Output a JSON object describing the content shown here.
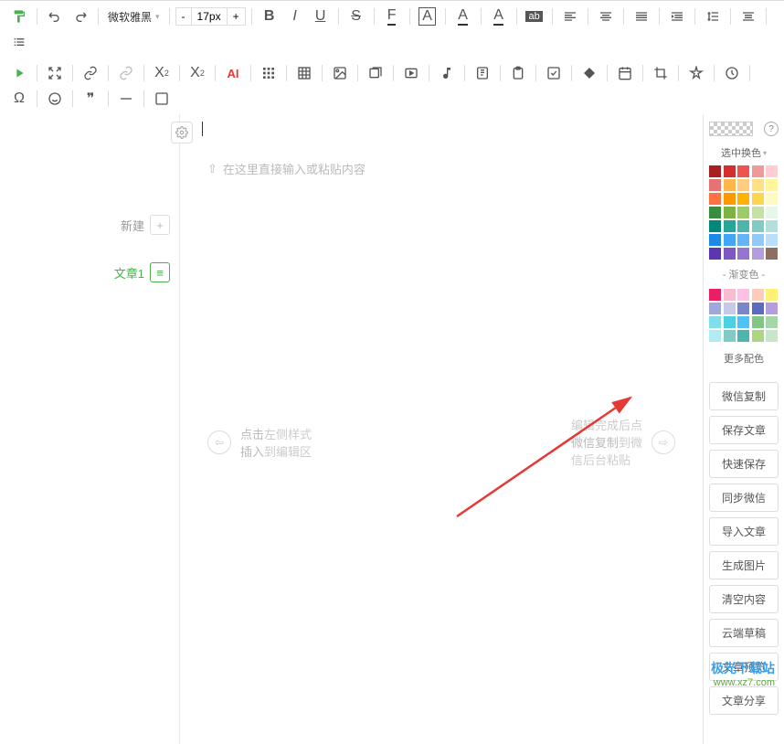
{
  "toolbar": {
    "font_family": "微软雅黑",
    "font_size": "17px",
    "minus": "-",
    "plus": "+"
  },
  "sidebar": {
    "new_label": "新建",
    "article_label": "文章1"
  },
  "editor": {
    "placeholder_text": "在这里直接输入或粘贴内容",
    "left_hint_1": "点击",
    "left_hint_2": "左侧样式",
    "left_hint_3": "插入",
    "left_hint_4": "到编辑区",
    "right_hint_1": "编辑完成后点",
    "right_hint_2": "微信复制",
    "right_hint_3": "到微",
    "right_hint_4": "信后台粘贴"
  },
  "colors": {
    "select_label": "选中换色",
    "gradient_label": "- 渐变色 -",
    "more_label": "更多配色",
    "solid": [
      "#a91e1e",
      "#d32f2f",
      "#ef5350",
      "#ef9a9a",
      "#ffcdd2",
      "#e57373",
      "#ffb74d",
      "#ffcc80",
      "#ffe082",
      "#fff59d",
      "#ff7043",
      "#ff9800",
      "#ffb300",
      "#ffd54f",
      "#fff9c4",
      "#388e3c",
      "#7cb342",
      "#9ccc65",
      "#c5e1a5",
      "#e8f5e9",
      "#00897b",
      "#26a69a",
      "#4db6ac",
      "#80cbc4",
      "#b2dfdb",
      "#1e88e5",
      "#42a5f5",
      "#64b5f6",
      "#90caf9",
      "#bbdefb",
      "#5e35b1",
      "#7e57c2",
      "#9575cd",
      "#b39ddb",
      "#8d6e63"
    ],
    "gradient": [
      "#e91e63",
      "#f8bbd0",
      "#ffc1e3",
      "#ffccbc",
      "#fff176",
      "#9fa8da",
      "#c5cae9",
      "#7986cb",
      "#5c6bc0",
      "#b39ddb",
      "#80deea",
      "#4dd0e1",
      "#4fc3f7",
      "#81c784",
      "#a5d6a7",
      "#b2ebf2",
      "#80cbc4",
      "#4db6ac",
      "#aed581",
      "#c8e6c9"
    ]
  },
  "actions": [
    {
      "id": "wechat-copy",
      "label": "微信复制"
    },
    {
      "id": "save-article",
      "label": "保存文章"
    },
    {
      "id": "quick-save",
      "label": "快速保存"
    },
    {
      "id": "sync-wechat",
      "label": "同步微信"
    },
    {
      "id": "import-article",
      "label": "导入文章"
    },
    {
      "id": "gen-image",
      "label": "生成图片"
    },
    {
      "id": "clear-content",
      "label": "清空内容"
    },
    {
      "id": "cloud-draft",
      "label": "云端草稿"
    },
    {
      "id": "preview",
      "label": "文章预览"
    },
    {
      "id": "share",
      "label": "文章分享"
    }
  ],
  "watermark": {
    "line1": "极光下载站",
    "line2": "www.xz7.com"
  }
}
